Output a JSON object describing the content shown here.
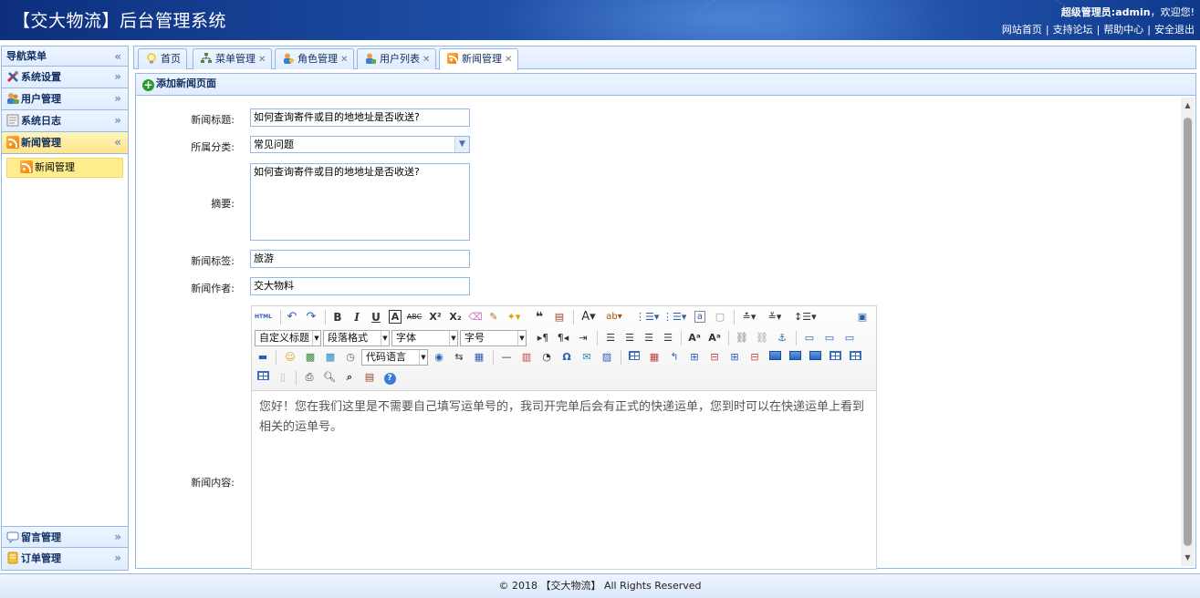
{
  "header": {
    "title": "【交大物流】后台管理系统",
    "welcome_user": "超级管理员:admin",
    "welcome_suffix": "，欢迎您!",
    "links": [
      "网站首页",
      "支持论坛",
      "帮助中心",
      "安全退出"
    ]
  },
  "nav": {
    "title": "导航菜单",
    "groups_top": [
      {
        "label": "系统设置",
        "icon": "tools-icon"
      },
      {
        "label": "用户管理",
        "icon": "users-icon"
      },
      {
        "label": "系统日志",
        "icon": "log-icon"
      },
      {
        "label": "新闻管理",
        "icon": "rss-icon",
        "active": true
      }
    ],
    "sub_item": "新闻管理",
    "groups_bottom": [
      {
        "label": "留言管理",
        "icon": "message-icon"
      },
      {
        "label": "订单管理",
        "icon": "order-icon"
      }
    ]
  },
  "tabs": [
    {
      "label": "首页",
      "icon": "bulb-icon",
      "closable": false
    },
    {
      "label": "菜单管理",
      "icon": "tree-icon",
      "closable": true
    },
    {
      "label": "角色管理",
      "icon": "role-icon",
      "closable": true
    },
    {
      "label": "用户列表",
      "icon": "users-icon",
      "closable": true
    },
    {
      "label": "新闻管理",
      "icon": "rss-icon",
      "closable": true,
      "active": true
    }
  ],
  "panel": {
    "title": "添加新闻页面"
  },
  "form": {
    "title_label": "新闻标题:",
    "title_value": "如何查询寄件或目的地地址是否收送?",
    "category_label": "所属分类:",
    "category_value": "常见问题",
    "summary_label": "摘要:",
    "summary_value": "如何查询寄件或目的地地址是否收送?",
    "tags_label": "新闻标签:",
    "tags_value": "旅游",
    "author_label": "新闻作者:",
    "author_value": "交大物料",
    "content_label": "新闻内容:"
  },
  "editor": {
    "html_label": "HTML",
    "combo_heading": "自定义标题",
    "combo_paragraph": "段落格式",
    "combo_font": "字体",
    "combo_size": "字号",
    "combo_code": "代码语言",
    "content": "您好！您在我们这里是不需要自己填写运单号的，我司开完单后会有正式的快递运单，您到时可以在快递运单上看到相关的运单号。"
  },
  "footer": {
    "text": "© 2018 【交大物流】 All Rights Reserved"
  }
}
